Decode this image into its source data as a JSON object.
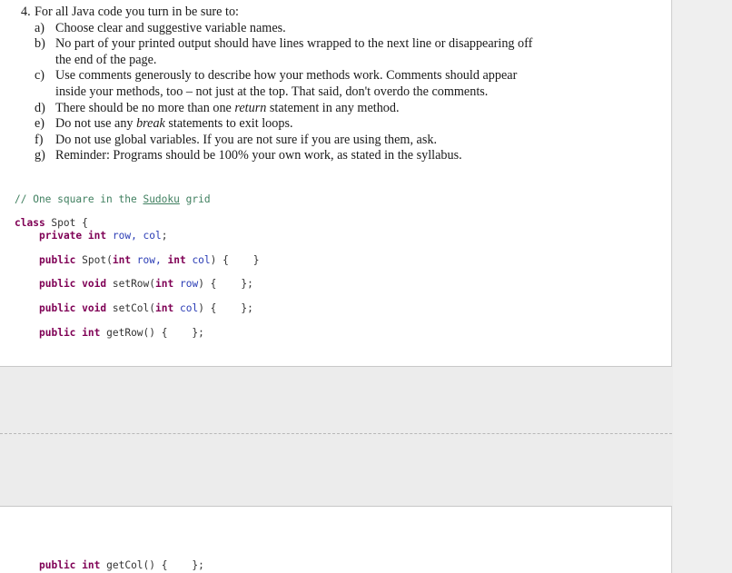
{
  "instructions": {
    "number": "4.",
    "heading": "For all Java code you turn in be sure to:",
    "items": [
      {
        "letter": "a)",
        "lines": [
          "Choose clear and suggestive variable names."
        ]
      },
      {
        "letter": "b)",
        "lines": [
          "No part of your printed output should have lines wrapped to the next line or disappearing off",
          "the end of the page."
        ]
      },
      {
        "letter": "c)",
        "lines": [
          "Use comments generously to describe how your methods work. Comments should appear",
          "inside your methods, too – not just at the top. That said, don't overdo the comments."
        ]
      },
      {
        "letter": "d)",
        "pre": "There should be no more than one ",
        "em": "return",
        "post": " statement in any method."
      },
      {
        "letter": "e)",
        "pre": "Do not use any ",
        "em": "break",
        "post": " statements to exit loops."
      },
      {
        "letter": "f)",
        "lines": [
          "Do not use global variables. If you are not sure if you are using them, ask."
        ]
      },
      {
        "letter": "g)",
        "lines": [
          "Reminder: Programs should be 100% your own work, as stated in the syllabus."
        ]
      }
    ]
  },
  "code": {
    "comment_prefix": "// One square in the ",
    "comment_word": "Sudoku",
    "comment_suffix": " grid",
    "class_kw": "class",
    "class_rest": " Spot {",
    "field_line": {
      "kw1": "private",
      "kw2": "int",
      "vars": "row, col",
      "end": ";"
    },
    "methods": [
      {
        "name": "constructor",
        "kw": "public",
        "mid": " Spot(",
        "type": "int",
        "param1": " row, ",
        "type2": "int",
        "param2": " col",
        "end": ") {    }"
      },
      {
        "name": "setRow",
        "kw": "public",
        "kw2": "void",
        "mid": " setRow(",
        "type": "int",
        "param": " row",
        "end": ") {    };"
      },
      {
        "name": "setCol",
        "kw": "public",
        "kw2": "void",
        "mid": " setCol(",
        "type": "int",
        "param": " col",
        "end": ") {    };"
      },
      {
        "name": "getRow",
        "kw": "public",
        "kw2": "int",
        "mid": " getRow() {    };"
      }
    ],
    "page2_method": {
      "kw": "public",
      "kw2": "int",
      "mid": " getCol() {    };"
    }
  }
}
